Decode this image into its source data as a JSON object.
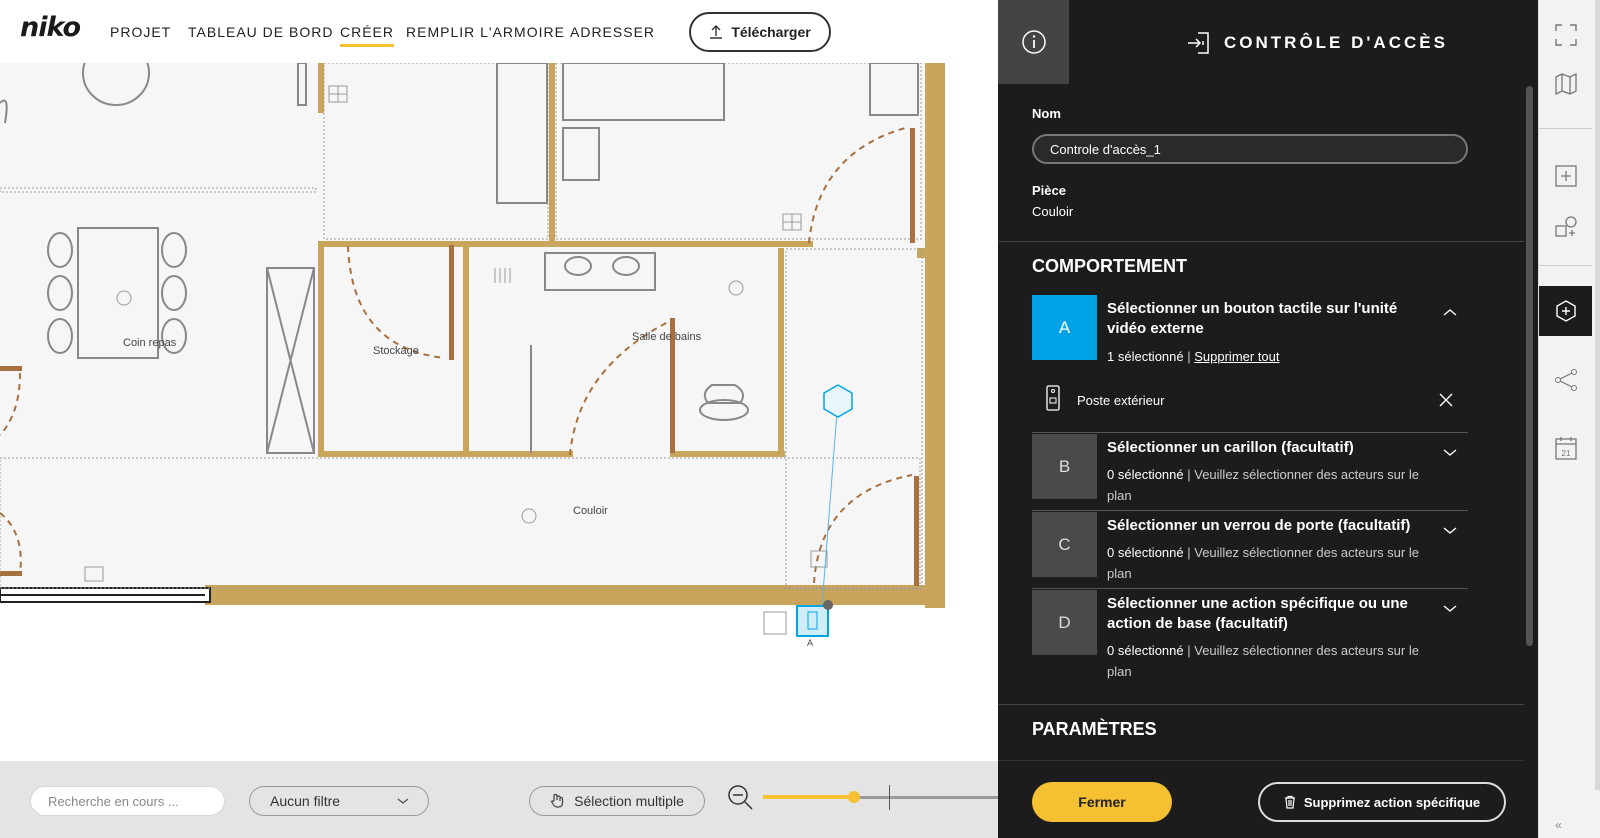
{
  "nav": {
    "logo": "niko",
    "items": [
      {
        "label": "PROJET"
      },
      {
        "label": "TABLEAU DE BORD"
      },
      {
        "label": "CRÉER",
        "active": true
      },
      {
        "label": "REMPLIR L'ARMOIRE"
      },
      {
        "label": "ADRESSER"
      }
    ],
    "download_label": "Télécharger"
  },
  "floorplan": {
    "rooms": [
      {
        "label": "Coin repas"
      },
      {
        "label": "Stockage"
      },
      {
        "label": "Salle de bains"
      },
      {
        "label": "Couloir"
      }
    ],
    "selected_device_label": "A"
  },
  "bottombar": {
    "search_placeholder": "Recherche en cours ...",
    "filter_value": "Aucun filtre",
    "multi_select_label": "Sélection multiple",
    "zoom_level": 0.38
  },
  "panel": {
    "title": "CONTRÔLE D'ACCÈS",
    "name_label": "Nom",
    "name_value": "Controle d'accès_1",
    "room_label": "Pièce",
    "room_value": "Couloir",
    "behavior_heading": "COMPORTEMENT",
    "behaviors": [
      {
        "badge": "A",
        "title": "Sélectionner un bouton tactile sur l'unité vidéo externe",
        "count": "1 sélectionné",
        "extra": "Supprimer tout",
        "expanded": true
      },
      {
        "badge": "B",
        "title": "Sélectionner un carillon (facultatif)",
        "count": "0 sélectionné",
        "extra": "Veuillez sélectionner des acteurs sur le plan"
      },
      {
        "badge": "C",
        "title": "Sélectionner un verrou de porte (facultatif)",
        "count": "0 sélectionné",
        "extra": "Veuillez sélectionner des acteurs sur le plan"
      },
      {
        "badge": "D",
        "title": "Sélectionner une action spécifique ou une action de base (facultatif)",
        "count": "0 sélectionné",
        "extra": "Veuillez sélectionner des acteurs sur le plan"
      }
    ],
    "selected_device": "Poste extérieur",
    "params_heading": "PARAMÈTRES",
    "close_label": "Fermer",
    "delete_label": "Supprimez action spécifique"
  },
  "colors": {
    "accent": "#f5c031",
    "selected_blue": "#00a3e6",
    "wall": "#c8a55a",
    "door": "#a8703e",
    "panel_bg": "#1c1c1c"
  },
  "rail": {
    "icons": [
      "fullscreen-icon",
      "map-icon",
      "add-box-icon",
      "add-shape-icon",
      "add-hex-icon",
      "connections-icon",
      "calendar-icon"
    ],
    "calendar_day": "21",
    "collapse": "«"
  }
}
